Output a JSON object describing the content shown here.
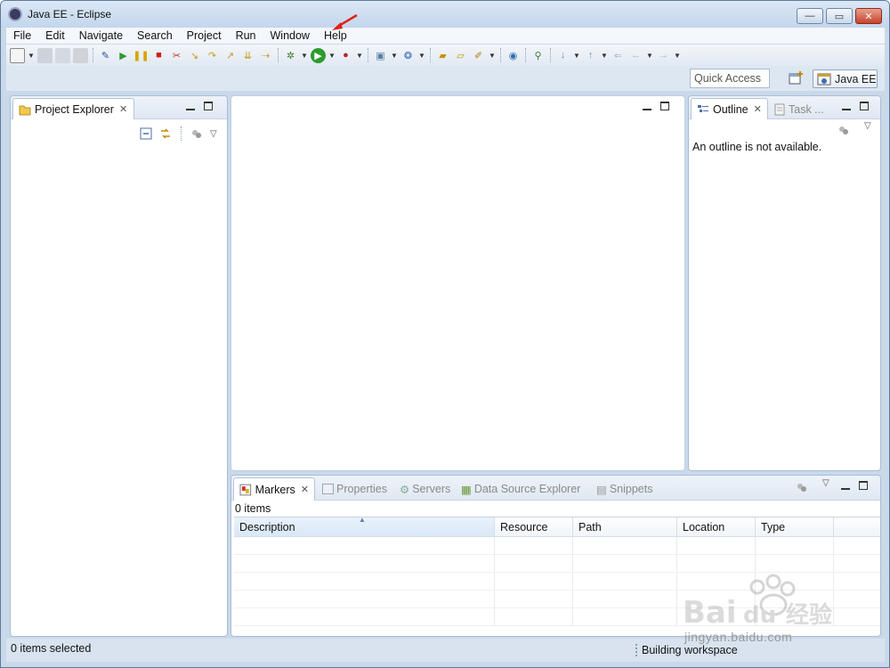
{
  "window": {
    "title": "Java EE - Eclipse",
    "controls": {
      "minimize": "—",
      "maximize": "▭",
      "close": "✕"
    }
  },
  "menu": [
    "File",
    "Edit",
    "Navigate",
    "Search",
    "Project",
    "Run",
    "Window",
    "Help"
  ],
  "toolbar": {
    "quick_access_placeholder": "Quick Access",
    "perspective_label": "Java EE"
  },
  "project_explorer": {
    "tab_label": "Project Explorer"
  },
  "outline": {
    "tab_label": "Outline",
    "second_tab_label": "Task ...",
    "message": "An outline is not available."
  },
  "bottom_panel": {
    "tabs": [
      "Markers",
      "Properties",
      "Servers",
      "Data Source Explorer",
      "Snippets"
    ],
    "items_count": "0 items",
    "columns": [
      "Description",
      "Resource",
      "Path",
      "Location",
      "Type"
    ]
  },
  "status": {
    "left": "0 items selected",
    "right": "Building workspace"
  },
  "watermark": {
    "logo": "Baidu 经验",
    "url": "jingyan.baidu.com"
  },
  "colors": {
    "frame": "#c9d9ea",
    "panel_border": "#a9bdd4",
    "annotation_arrow": "#e0201a"
  }
}
